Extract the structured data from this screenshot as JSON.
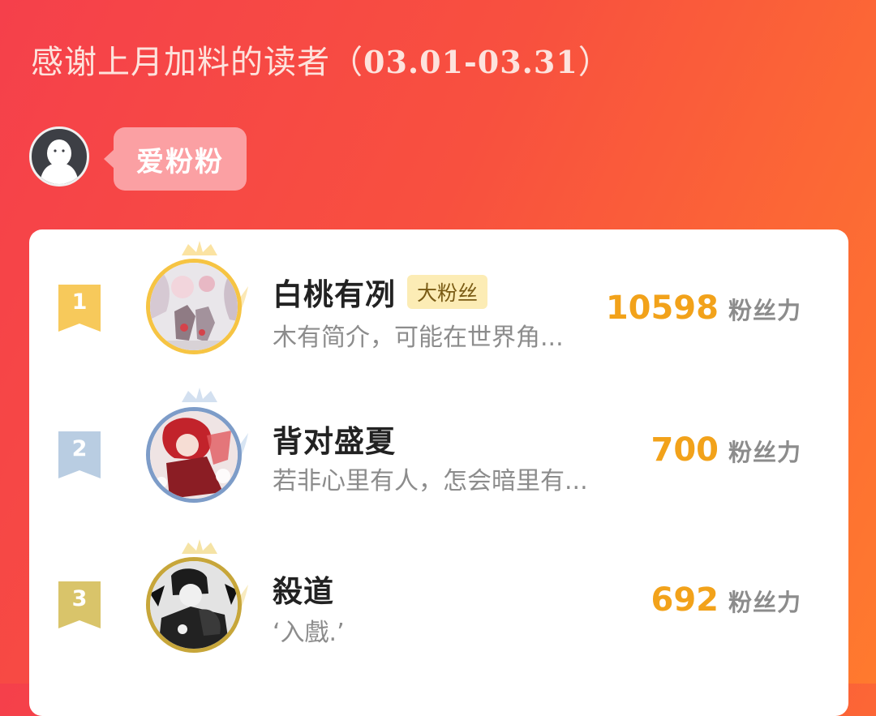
{
  "header": {
    "title_text": "感谢上月加料的读者（",
    "date_range": "03.01-03.31",
    "title_close": "）"
  },
  "host": {
    "name": "爱粉粉",
    "avatar_icon": "default-user-avatar-icon"
  },
  "ranking": [
    {
      "rank": "1",
      "name": "白桃有冽",
      "tag": "大粉丝",
      "bio": "木有简介，可能在世界角...",
      "score": "10598",
      "unit": "粉丝力",
      "badge_color": "#f7c95b",
      "ring_color": "#f6c443"
    },
    {
      "rank": "2",
      "name": "背对盛夏",
      "tag": "",
      "bio": "若非心里有人，怎会暗里有...",
      "score": "700",
      "unit": "粉丝力",
      "badge_color": "#b9cde2",
      "ring_color": "#7d9cc8"
    },
    {
      "rank": "3",
      "name": "殺道",
      "tag": "",
      "bio": "‘入戲.’",
      "score": "692",
      "unit": "粉丝力",
      "badge_color": "#d9c46a",
      "ring_color": "#c7a63a"
    }
  ],
  "colors": {
    "accent_score": "#f2a21a",
    "bg_start": "#f5404b",
    "bg_end": "#ff7a2e"
  }
}
